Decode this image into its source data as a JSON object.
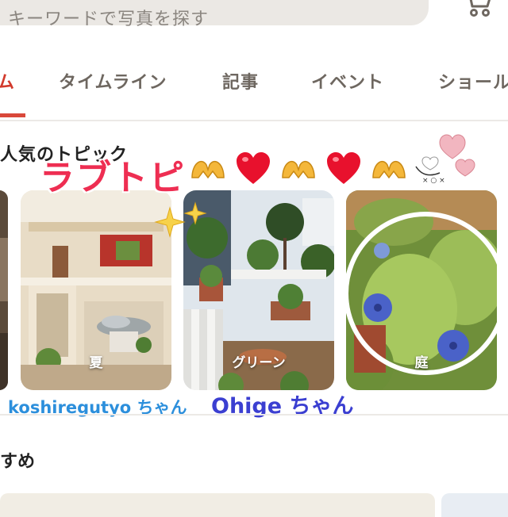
{
  "search": {
    "partial_text": "キーワードで写真を探す"
  },
  "tabs": [
    {
      "label": "ム",
      "active": true
    },
    {
      "label": "タイムライン",
      "active": false
    },
    {
      "label": "記事",
      "active": false
    },
    {
      "label": "イベント",
      "active": false
    },
    {
      "label": "ショール",
      "active": false
    }
  ],
  "section": {
    "title": "人気のトピック"
  },
  "overlay": {
    "title": "ラブトピ",
    "caption_left": "koshiregutyo ちゃん",
    "caption_right": "Ohige ちゃん"
  },
  "cards": [
    {
      "label": ""
    },
    {
      "label": "夏"
    },
    {
      "label": "グリーン"
    },
    {
      "label": "庭"
    }
  ],
  "section2": {
    "title": "すめ"
  },
  "colors": {
    "accent": "#d9483a",
    "love_title": "#ee2e52",
    "caption_left": "#2c8fdc",
    "caption_right": "#3b3fd1"
  },
  "icons": [
    "cart-icon",
    "heart-hands-icon",
    "red-heart-icon",
    "sparkle-star-icon",
    "pink-hearts-icon"
  ]
}
